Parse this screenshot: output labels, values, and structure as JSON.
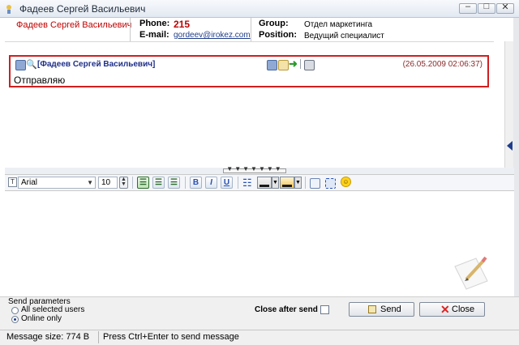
{
  "window": {
    "title": "Фадеев Сергей Васильевич"
  },
  "header": {
    "name": "Фадеев Сергей Васильевич",
    "phone_label": "Phone:",
    "phone_value": "215",
    "email_label": "E-mail:",
    "email_value": "gordeev@irokez.com",
    "group_label": "Group:",
    "group_value": "Отдел маркетинга",
    "position_label": "Position:",
    "position_value": "Ведущий специалист"
  },
  "message": {
    "author": "[Фадеев Сергей Васильевич]",
    "date": "(26.05.2009 02:06:37)",
    "text": "Отправляю"
  },
  "toolbar": {
    "font": "Arial",
    "size": "10",
    "bold": "B",
    "italic": "I",
    "underline": "U"
  },
  "send_params": {
    "title": "Send parameters",
    "option_all": "All selected users",
    "option_online": "Online only",
    "selected": "online"
  },
  "actions": {
    "close_after_send": "Close after send",
    "close_after_send_checked": false,
    "send": "Send",
    "close": "Close"
  },
  "status": {
    "size": "Message size: 774 B",
    "hint": "Press Ctrl+Enter to send message"
  },
  "colors": {
    "name": "#c00000",
    "phone": "#c00000",
    "author": "#1f2f88",
    "highlight_border": "#d01f1f"
  }
}
